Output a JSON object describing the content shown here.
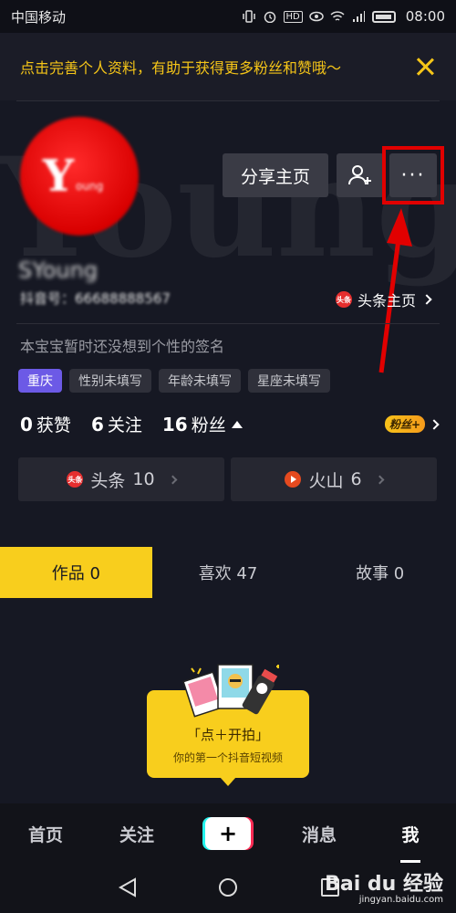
{
  "status_bar": {
    "carrier": "中国移动",
    "time": "08:00"
  },
  "banner": {
    "text": "点击完善个人资料，有助于获得更多粉丝和赞哦～"
  },
  "profile": {
    "avatar_text": "Y",
    "avatar_sub": "oung",
    "username": "SYoung",
    "douyin_id": "抖音号：66688888567",
    "toutiao_link": "头条主页",
    "bio": "本宝宝暂时还没想到个性的签名",
    "tags": [
      "重庆",
      "性别未填写",
      "年龄未填写",
      "星座未填写"
    ]
  },
  "buttons": {
    "share": "分享主页",
    "more": "···"
  },
  "stats": {
    "likes_num": "0",
    "likes_label": "获赞",
    "following_num": "6",
    "following_label": "关注",
    "fans_num": "16",
    "fans_label": "粉丝",
    "fans_badge": "粉丝+"
  },
  "cards": [
    {
      "label": "头条",
      "count": "10",
      "badge": "头条"
    },
    {
      "label": "火山",
      "count": "6"
    }
  ],
  "tabs": [
    {
      "label": "作品 0",
      "active": true
    },
    {
      "label": "喜欢 47",
      "active": false
    },
    {
      "label": "故事 0",
      "active": false
    }
  ],
  "empty": {
    "title": "「点＋开拍」",
    "subtitle": "你的第一个抖音短视频"
  },
  "bottom_nav": [
    {
      "label": "首页"
    },
    {
      "label": "关注"
    },
    {
      "label": "+"
    },
    {
      "label": "消息"
    },
    {
      "label": "我"
    }
  ],
  "watermark": {
    "brand": "Bai du 经验",
    "url": "jingyan.baidu.com"
  },
  "colors": {
    "accent": "#f8ce1d",
    "highlight": "#e10000",
    "tag_location": "#6c5ae6",
    "background": "#161823"
  }
}
